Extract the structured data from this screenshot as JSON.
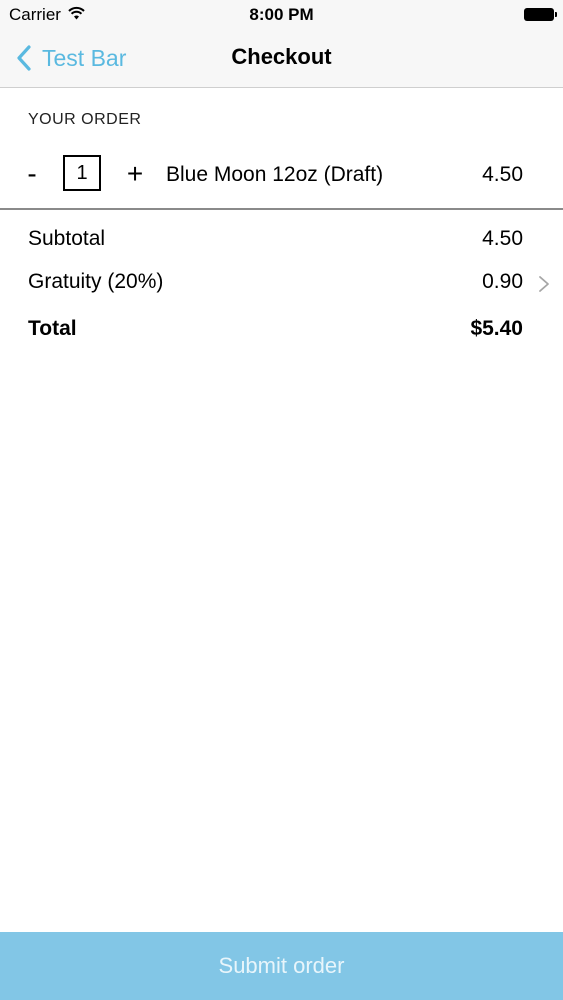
{
  "status_bar": {
    "carrier": "Carrier",
    "time": "8:00 PM",
    "icons": [
      "wifi-icon",
      "battery-icon"
    ]
  },
  "nav": {
    "back_label": "Test Bar",
    "title": "Checkout",
    "accent_color": "#5ab9e0"
  },
  "order": {
    "section_header": "YOUR ORDER",
    "items": [
      {
        "minus_label": "-",
        "quantity": "1",
        "plus_label": "+",
        "name": "Blue Moon 12oz (Draft)",
        "price": "4.50"
      }
    ]
  },
  "summary": {
    "subtotal_label": "Subtotal",
    "subtotal_value": "4.50",
    "gratuity_label": "Gratuity (20%)",
    "gratuity_value": "0.90",
    "total_label": "Total",
    "total_value": "$5.40"
  },
  "submit": {
    "label": "Submit order",
    "background_color": "#82c6e6"
  }
}
